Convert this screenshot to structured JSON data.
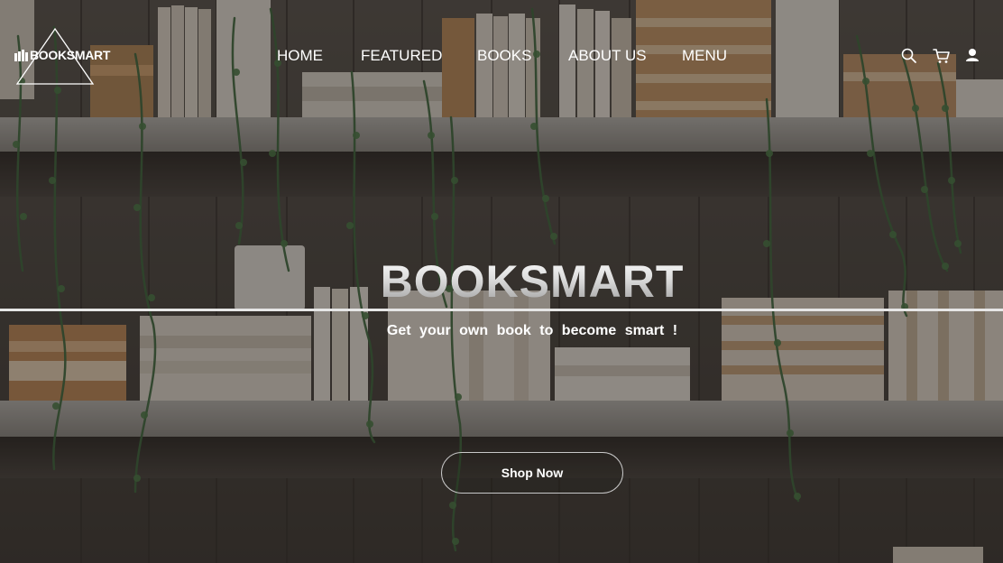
{
  "brand": {
    "logo_text": "BOOKSMART"
  },
  "nav": {
    "items": [
      {
        "label": "HOME"
      },
      {
        "label": "FEATURED"
      },
      {
        "label": "BOOKS"
      },
      {
        "label": "ABOUT US"
      },
      {
        "label": "MENU"
      }
    ]
  },
  "header_icons": [
    "search-icon",
    "cart-icon",
    "user-icon"
  ],
  "hero": {
    "title": "BOOKSMART",
    "subtitle": "Get your own book to become smart !",
    "cta_label": "Shop Now"
  },
  "colors": {
    "text": "#ffffff",
    "overlay": "#2a2623",
    "button_border": "#c8c8c8"
  }
}
